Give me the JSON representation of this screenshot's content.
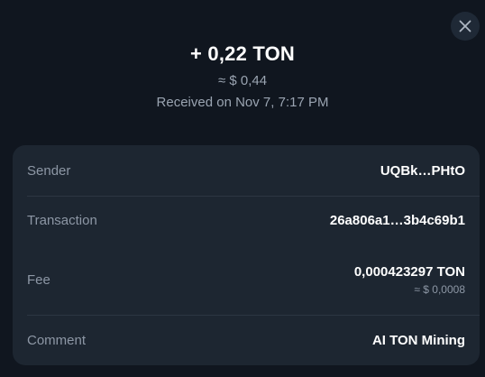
{
  "header": {
    "amount": "+ 0,22 TON",
    "fiat": "≈ $ 0,44",
    "date": "Received on Nov 7, 7:17 PM"
  },
  "close": {
    "icon": "close-icon"
  },
  "details": {
    "sender": {
      "label": "Sender",
      "value": "UQBk…PHtO"
    },
    "transaction": {
      "label": "Transaction",
      "value": "26a806a1…3b4c69b1"
    },
    "fee": {
      "label": "Fee",
      "value": "0,000423297 TON",
      "fiat": "≈ $ 0,0008"
    },
    "comment": {
      "label": "Comment",
      "value": "AI TON Mining"
    }
  },
  "colors": {
    "background": "#10161f",
    "card": "#1d2631",
    "secondary_text": "#9aa4b1",
    "primary_text": "#ffffff"
  }
}
